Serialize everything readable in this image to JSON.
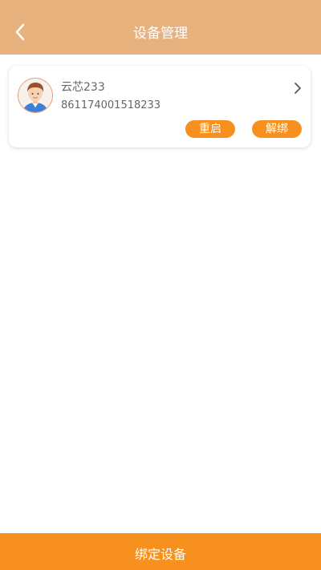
{
  "header": {
    "title": "设备管理",
    "back_icon": "chevron-left-icon"
  },
  "device": {
    "name": "云芯233",
    "id": "861174001518233",
    "avatar_icon": "user-avatar-icon",
    "detail_icon": "chevron-right-icon",
    "restart_label": "重启",
    "unbind_label": "解绑"
  },
  "footer": {
    "bind_label": "绑定设备"
  },
  "colors": {
    "header_bg": "#e8b27f",
    "accent": "#f7901e",
    "text_secondary": "#666666"
  }
}
